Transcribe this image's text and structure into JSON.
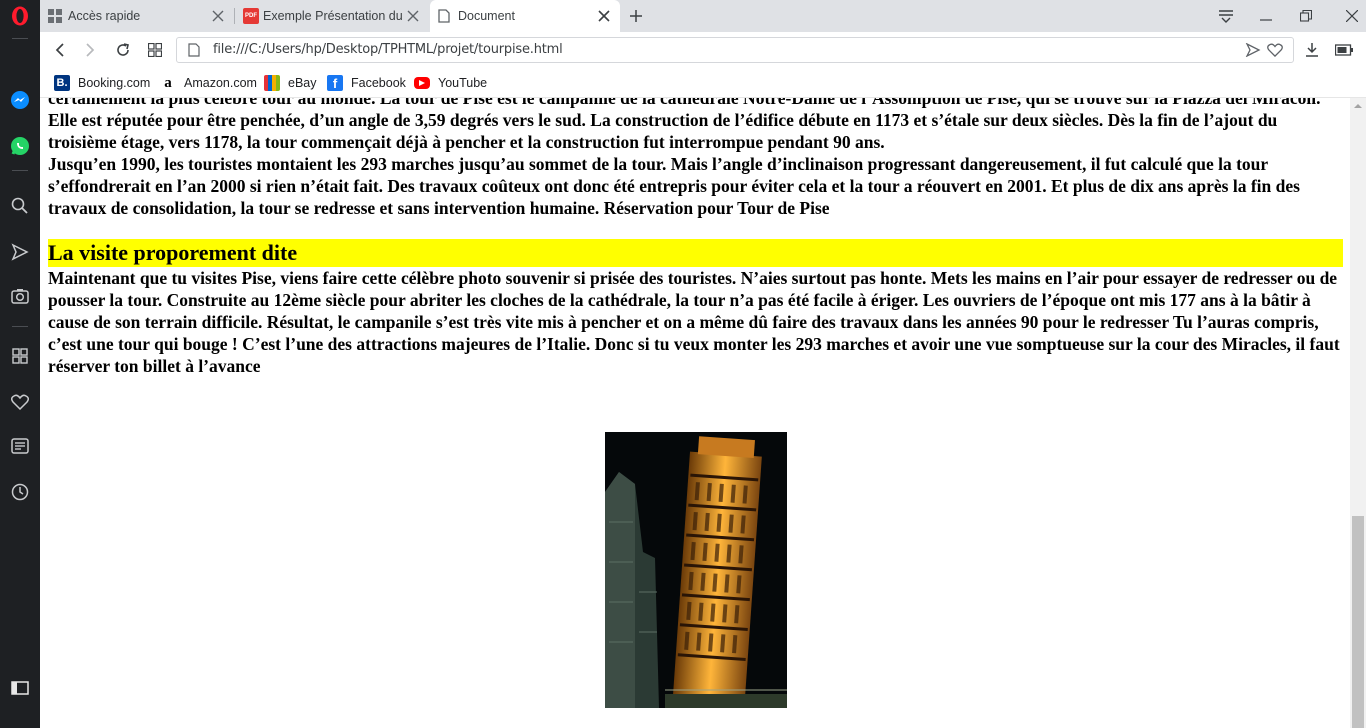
{
  "tabs": [
    {
      "title": "Accès rapide",
      "icon": "grid-icon"
    },
    {
      "title": "Exemple Présentation du p",
      "icon": "pdf-icon"
    },
    {
      "title": "Document",
      "icon": "document-icon"
    }
  ],
  "address": {
    "url": "file:///C:/Users/hp/Desktop/TPHTML/projet/tourpise.html"
  },
  "bookmarks": [
    {
      "label": "Booking.com",
      "icon": "booking-icon",
      "color": "#003580"
    },
    {
      "label": "Amazon.com",
      "icon": "amazon-icon",
      "color": "#000000"
    },
    {
      "label": "eBay",
      "icon": "ebay-icon",
      "color": "#e53238"
    },
    {
      "label": "Facebook",
      "icon": "facebook-icon",
      "color": "#1877f2"
    },
    {
      "label": "YouTube",
      "icon": "youtube-icon",
      "color": "#ff0000"
    }
  ],
  "article": {
    "para1_line1": "certainement la plus célèbre tour au monde. La tour de Pise est le campanile de la cathédrale Notre-Dame de l’Assomption de Pise, qui se trouve sur la Piazza dei Miracoli. Elle est réputée pour être penchée, d’un angle de 3,59 degrés vers le sud. La construction de l’édifice débute en 1173 et s’étale sur deux siècles. Dès la fin de l’ajout du troisième étage, vers 1178, la tour commençait déjà à pencher et la construction fut interrompue pendant 90 ans.",
    "para1_line2": "Jusqu’en 1990, les touristes montaient les 293 marches jusqu’au sommet de la tour. Mais l’angle d’inclinaison progressant dangereusement, il fut calculé que la tour s’effondrerait en l’an 2000 si rien n’était fait. Des travaux coûteux ont donc été entrepris pour éviter cela et la tour a réouvert en 2001. Et plus de dix ans après la fin des travaux de consolidation, la tour se redresse et sans intervention humaine. Réservation pour Tour de Pise",
    "heading": "La visite proporement dite",
    "para2": "Maintenant que tu visites Pise, viens faire cette célèbre photo souvenir si prisée des touristes. N’aies surtout pas honte. Mets les mains en l’air pour essayer de redresser ou de pousser la tour. Construite au 12ème siècle pour abriter les cloches de la cathédrale, la tour n’a pas été facile à ériger. Les ouvriers de l’époque ont mis 177 ans à la bâtir à cause de son terrain difficile. Résultat, le campanile s’est très vite mis à pencher et on a même dû faire des travaux dans les années 90 pour le redresser Tu l’auras compris, c’est une tour qui bouge ! C’est l’une des attractions majeures de l’Italie. Donc si tu veux monter les 293 marches et avoir une vue somptueuse sur la cour des Miracles, il faut réserver ton billet à l’avance"
  },
  "colors": {
    "heading_bg": "#ffff00",
    "sidebar_bg": "#1e2023",
    "opera_red": "#ff1b2d"
  }
}
